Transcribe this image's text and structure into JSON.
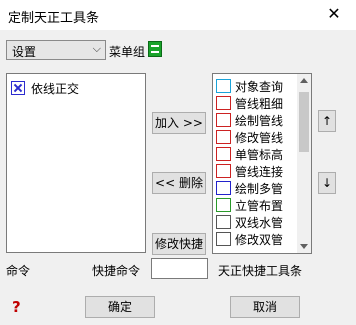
{
  "window": {
    "title": "定制天正工具条",
    "close_glyph": "✕"
  },
  "toolbar_select": {
    "value": "设置",
    "arrow_glyph": "⌵"
  },
  "menu_group_label": "菜单组",
  "left_list": {
    "items": [
      {
        "icon": "orthogonal-snap-icon",
        "label": "依线正交"
      }
    ]
  },
  "buttons": {
    "add": "加入 >>",
    "delete": "<< 删除",
    "modify_shortcut": "修改快捷",
    "move_up": "↑",
    "move_down": "↓",
    "ok": "确定",
    "cancel": "取消"
  },
  "right_list": {
    "items": [
      {
        "icon": "object-query-icon",
        "label": "对象查询",
        "color": "#1aa3d9"
      },
      {
        "icon": "pipe-thicken-icon",
        "label": "管线粗细",
        "color": "#cc2222"
      },
      {
        "icon": "draw-pipe-icon",
        "label": "绘制管线",
        "color": "#cc2222"
      },
      {
        "icon": "edit-pipe-icon",
        "label": "修改管线",
        "color": "#cc2222"
      },
      {
        "icon": "single-pipe-elevation-icon",
        "label": "单管标高",
        "color": "#cc2222"
      },
      {
        "icon": "pipe-connect-icon",
        "label": "管线连接",
        "color": "#cc2222"
      },
      {
        "icon": "draw-multi-pipe-icon",
        "label": "绘制多管",
        "color": "#2222cc"
      },
      {
        "icon": "riser-layout-icon",
        "label": "立管布置",
        "color": "#2a9a2a"
      },
      {
        "icon": "double-line-water-pipe-icon",
        "label": "双线水管",
        "color": "#333333"
      },
      {
        "icon": "edit-double-pipe-icon",
        "label": "修改双管",
        "color": "#333333"
      }
    ]
  },
  "labels": {
    "command": "命令",
    "shortcut_command": "快捷命令",
    "toolbar_name": "天正快捷工具条"
  },
  "shortcut_input": {
    "value": ""
  },
  "help_glyph": "?"
}
